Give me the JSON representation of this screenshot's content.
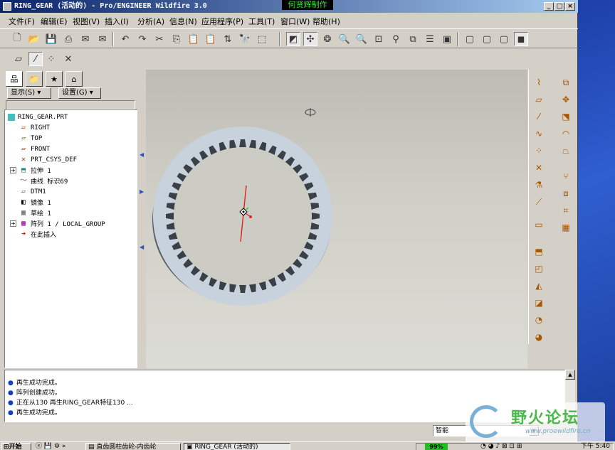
{
  "window": {
    "title": "RING_GEAR (活动的) - Pro/ENGINEER Wildfire 3.0",
    "watermark": "何贤辉制作"
  },
  "menus": [
    "文件(F)",
    "编辑(E)",
    "视图(V)",
    "插入(I)",
    "分析(A)",
    "信息(N)",
    "应用程序(P)",
    "工具(T)",
    "窗口(W)",
    "帮助(H)"
  ],
  "nav": {
    "show_label": "显示(S) ▾",
    "settings_label": "设置(G) ▾"
  },
  "tree": {
    "root": "RING_GEAR.PRT",
    "items": [
      "RIGHT",
      "TOP",
      "FRONT",
      "PRT_CSYS_DEF",
      "拉伸 1",
      "曲线 标识69",
      "DTM1",
      "镜像 1",
      "草绘 1",
      "阵列 1 / LOCAL_GROUP",
      "在此插入"
    ]
  },
  "messages": [
    "再生成功完成。",
    "阵列创建成功。",
    "正在从130 再生RING_GEAR特征130 ...",
    "再生成功完成。"
  ],
  "status": {
    "filter_value": "智能"
  },
  "taskbar": {
    "start": "开始",
    "task1": "直齿圆柱齿轮-内齿轮",
    "task2": "RING_GEAR (活动的)",
    "percent": "99%",
    "clock": "下午 5:40"
  },
  "logo": {
    "text": "野火论坛",
    "url": "www.proewildfire.cn"
  },
  "gear": {
    "teeth": 44
  }
}
